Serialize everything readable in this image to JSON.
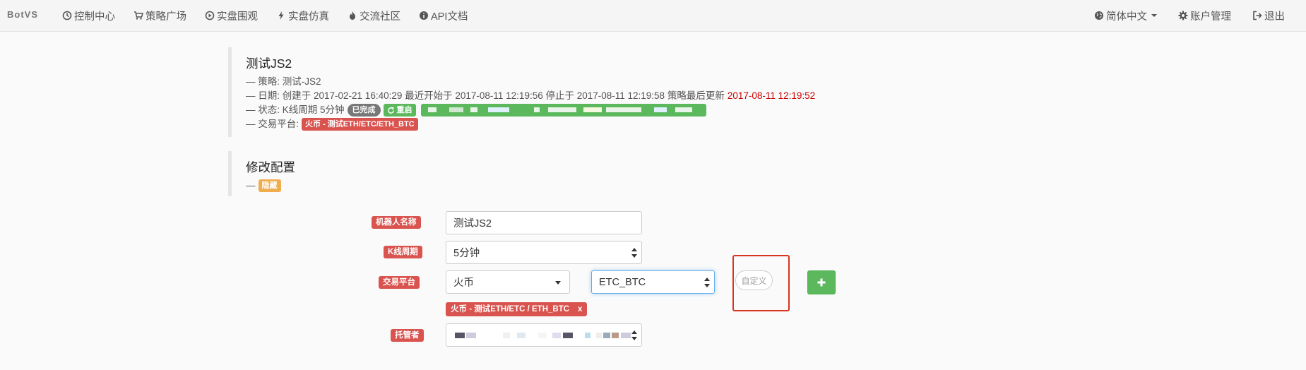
{
  "nav": {
    "brand": "BotVS",
    "items": [
      {
        "label": "控制中心",
        "icon": "dashboard-icon"
      },
      {
        "label": "策略广场",
        "icon": "cart-icon"
      },
      {
        "label": "实盘围观",
        "icon": "play-circle-icon"
      },
      {
        "label": "实盘仿真",
        "icon": "flash-icon"
      },
      {
        "label": "交流社区",
        "icon": "fire-icon"
      },
      {
        "label": "API文档",
        "icon": "info-icon"
      }
    ],
    "right": [
      {
        "label": "简体中文",
        "icon": "globe-icon"
      },
      {
        "label": "账户管理",
        "icon": "gear-icon"
      },
      {
        "label": "退出",
        "icon": "logout-icon"
      }
    ]
  },
  "robot": {
    "title": "测试JS2",
    "strategy_line": "— 策略: 测试-JS2",
    "date_line": "— 日期: 创建于 2017-02-21 16:40:29 最近开始于 2017-08-11 12:19:56 停止于 2017-08-11 12:19:58 策略最后更新",
    "date_updated": "2017-08-11 12:19:52",
    "status_prefix": "— 状态: K线周期 5分钟",
    "status_badge": "已完成",
    "restart_label": "重启",
    "platform_prefix": "— 交易平台:",
    "platform_tag": "火币 - 测试ETH/ETC/ETH_BTC"
  },
  "config": {
    "title": "修改配置",
    "dash": "—",
    "hidden_label": "隐藏"
  },
  "form": {
    "name_label": "机器人名称",
    "name_value": "测试JS2",
    "kline_label": "K线周期",
    "kline_value": "5分钟",
    "platform_label": "交易平台",
    "exchange_value": "火币",
    "pair_value": "ETC_BTC",
    "custom_label": "自定义",
    "platform_tag": "火币 - 测试ETH/ETC / ETH_BTC",
    "platform_tag_remove": "x",
    "host_label": "托管者"
  },
  "colors": {
    "danger": "#d9534f",
    "success": "#5cb85c",
    "warning": "#f0ad4e",
    "highlight": "#d9341f"
  }
}
